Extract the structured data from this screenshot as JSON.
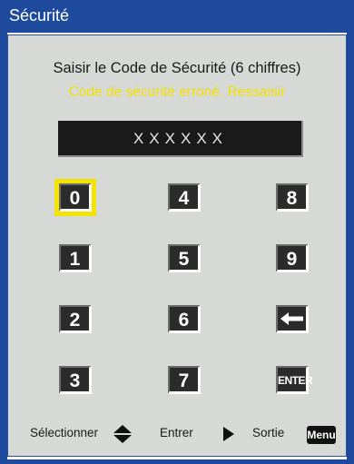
{
  "window": {
    "title": "Sécurité"
  },
  "dialog": {
    "prompt": "Saisir le Code de Sécurité (6 chiffres)",
    "error": "Code de sécurité erroné. Ressaisir",
    "code_display": "XXXXXX"
  },
  "keypad": {
    "selected_key": "0",
    "keys": [
      "0",
      "4",
      "8",
      "1",
      "5",
      "9",
      "2",
      "6",
      "backspace",
      "3",
      "7",
      "ENTER"
    ]
  },
  "footer": {
    "select_label": "Sélectionner",
    "enter_label": "Entrer",
    "exit_label": "Sortie",
    "menu_label": "Menu"
  },
  "colors": {
    "title_bar": "#1e4a9e",
    "panel": "#d7d9d6",
    "error_text": "#f2e100",
    "selection": "#f2e400",
    "key_face": "#2b2b2b"
  },
  "icons": {
    "select": "up-down-triangles-icon",
    "enter": "play-right-icon",
    "backspace": "left-arrow-icon"
  }
}
